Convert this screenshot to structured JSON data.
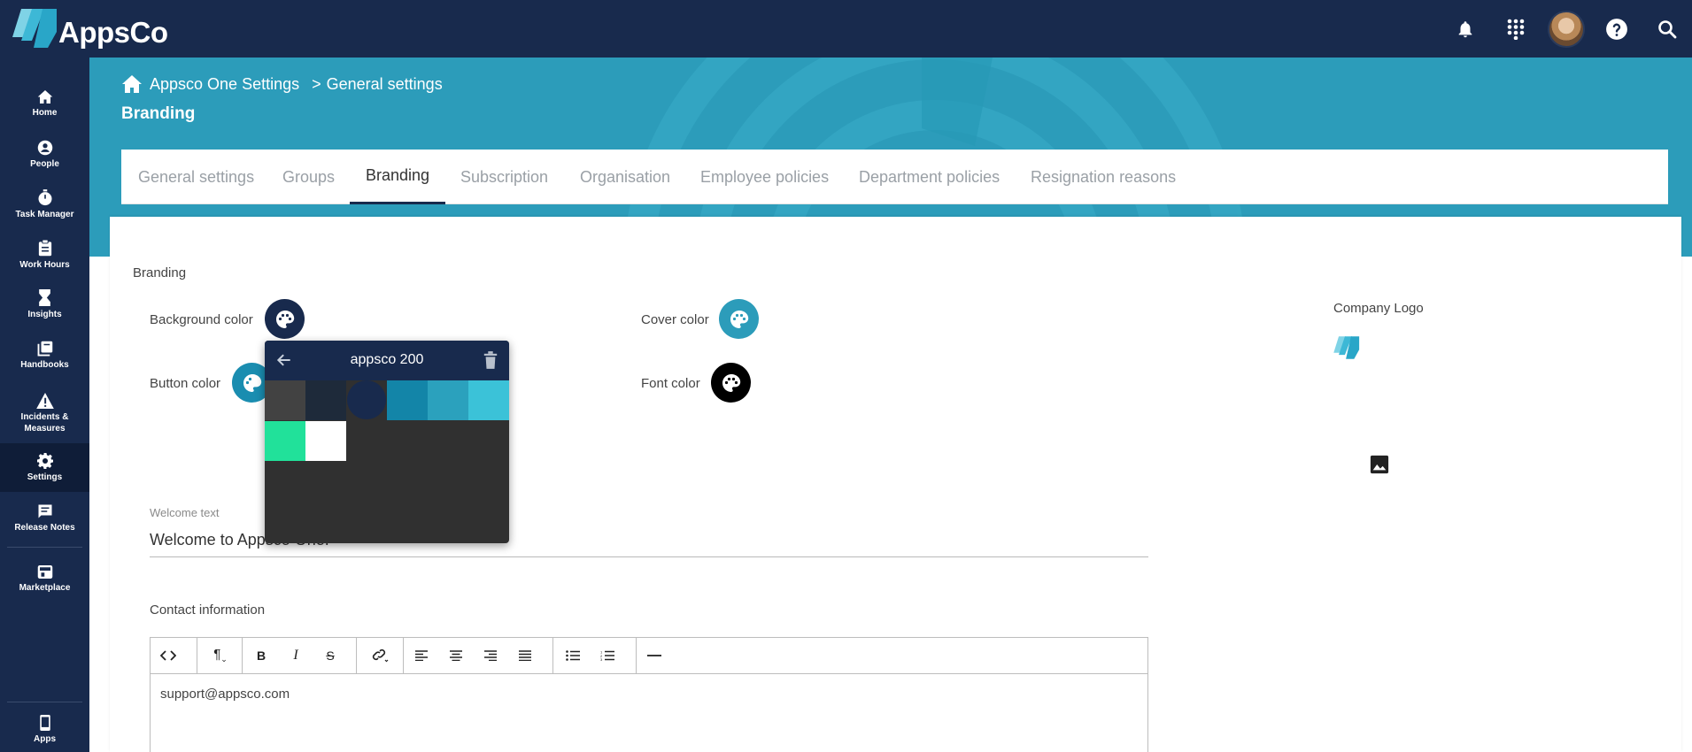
{
  "app": {
    "name": "AppsCo"
  },
  "sidebar": {
    "items": [
      {
        "label": "Home",
        "icon": "home-icon"
      },
      {
        "label": "People",
        "icon": "person-icon"
      },
      {
        "label": "Task Manager",
        "icon": "timer-icon"
      },
      {
        "label": "Work Hours",
        "icon": "clipboard-icon"
      },
      {
        "label": "Insights",
        "icon": "hourglass-icon"
      },
      {
        "label": "Handbooks",
        "icon": "books-icon"
      },
      {
        "label": "Incidents &",
        "label2": "Measures",
        "icon": "warning-icon"
      },
      {
        "label": "Settings",
        "icon": "gear-icon"
      },
      {
        "label": "Release Notes",
        "icon": "notes-icon"
      },
      {
        "label": "Marketplace",
        "icon": "store-icon"
      },
      {
        "label": "Apps",
        "icon": "phone-icon"
      }
    ]
  },
  "breadcrumb": {
    "root": "Appsco One Settings",
    "separator": ">",
    "current": "General settings"
  },
  "page_title": "Branding",
  "tabs": [
    {
      "label": "General settings"
    },
    {
      "label": "Groups"
    },
    {
      "label": "Branding"
    },
    {
      "label": "Subscription"
    },
    {
      "label": "Organisation"
    },
    {
      "label": "Employee policies"
    },
    {
      "label": "Department policies"
    },
    {
      "label": "Resignation reasons"
    }
  ],
  "branding": {
    "section_label": "Branding",
    "background_color_label": "Background color",
    "cover_color_label": "Cover color",
    "button_color_label": "Button color",
    "font_color_label": "Font color",
    "company_logo_label": "Company Logo",
    "colors": {
      "background": "#182a4d",
      "cover": "#2c9cba",
      "button": "#1a8db0",
      "font": "#000000"
    }
  },
  "picker": {
    "title": "appsco 200",
    "swatches": [
      "#424242",
      "#1e2a3a",
      "#182a4d",
      "#1385a8",
      "#2ba1bd",
      "#3bc2d8",
      "#21e19a",
      "#ffffff"
    ]
  },
  "welcome": {
    "label": "Welcome text",
    "value": "Welcome to Appsco One."
  },
  "contact": {
    "label": "Contact information",
    "body": "support@appsco.com",
    "toolbar": [
      "code-view",
      "paragraph",
      "bold",
      "italic",
      "strikethrough",
      "link",
      "align-left",
      "align-center",
      "align-right",
      "align-justify",
      "bullet-list",
      "ordered-list",
      "horizontal-rule"
    ]
  }
}
